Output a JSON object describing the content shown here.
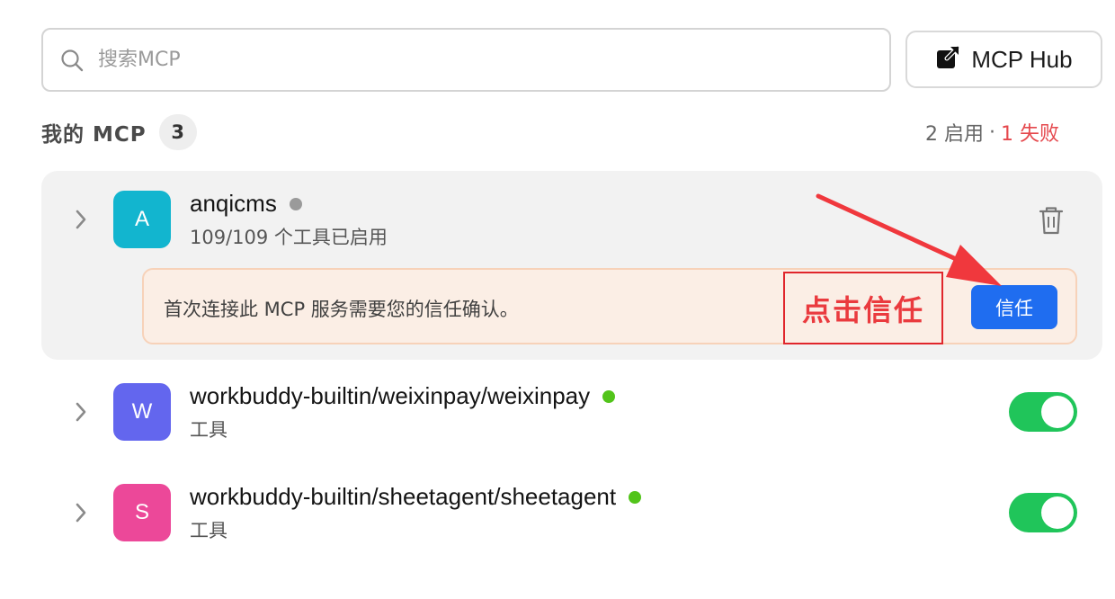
{
  "search": {
    "placeholder": "搜索MCP",
    "icon": "search-icon"
  },
  "hub_button": {
    "label": "MCP Hub",
    "icon": "external-link-icon"
  },
  "section": {
    "title": "我的 MCP",
    "count": "3"
  },
  "summary": {
    "enabled": "2 启用",
    "separator": "·",
    "failed": "1 失败",
    "failed_color": "#e5484d"
  },
  "servers": [
    {
      "avatar_letter": "A",
      "avatar_color": "#12b5cf",
      "name": "anqicms",
      "status_color": "#9a9a9a",
      "subtitle": "109/109 个工具已启用",
      "trust_message": "首次连接此 MCP 服务需要您的信任确认。",
      "trust_button": "信任",
      "annotation": "点击信任"
    },
    {
      "avatar_letter": "W",
      "avatar_color": "#6366ee",
      "name": "workbuddy-builtin/weixinpay/weixinpay",
      "status_color": "#52c41a",
      "subtitle": "工具",
      "enabled": true
    },
    {
      "avatar_letter": "S",
      "avatar_color": "#ec4899",
      "name": "workbuddy-builtin/sheetagent/sheetagent",
      "status_color": "#52c41a",
      "subtitle": "工具",
      "enabled": true
    }
  ]
}
